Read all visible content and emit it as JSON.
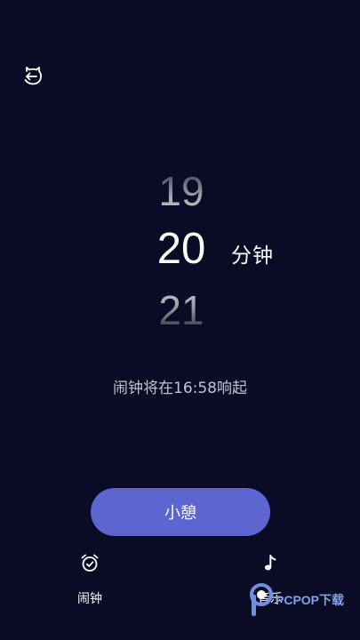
{
  "colors": {
    "background": "#0a0c26",
    "accent": "#5d66d0",
    "secondary_text": "#c2c4d2"
  },
  "header": {
    "back_icon": "back-arrow-icon"
  },
  "picker": {
    "prev_value": "19",
    "current_value": "20",
    "next_value": "21",
    "unit_label": "分钟"
  },
  "alarm_info": "闹钟将在16:58响起",
  "snooze_button": {
    "label": "小憩"
  },
  "bottom_tabs": [
    {
      "label": "闹钟",
      "icon": "alarm-clock-icon"
    },
    {
      "label": "音乐",
      "icon": "music-note-icon"
    }
  ],
  "watermark": {
    "text": "PCPOP下载"
  }
}
